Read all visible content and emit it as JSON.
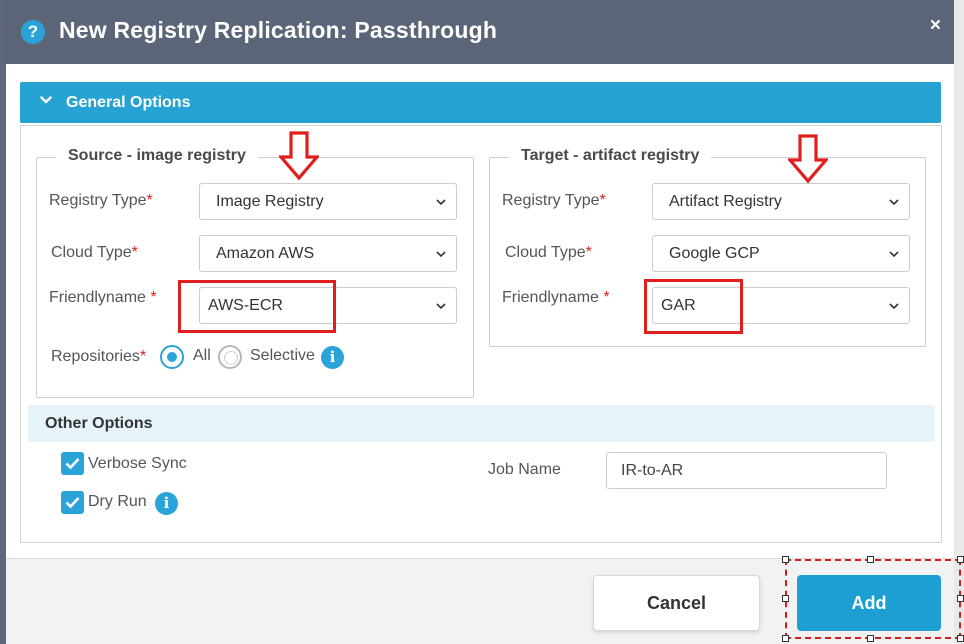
{
  "dialog": {
    "title": "New Registry Replication: Passthrough",
    "help_icon": "?",
    "close_icon": "×"
  },
  "section": {
    "title": "General Options"
  },
  "source": {
    "title": "Source - image registry",
    "registry_type_label": "Registry Type",
    "registry_type_value": "Image Registry",
    "cloud_type_label": "Cloud Type",
    "cloud_type_value": "Amazon AWS",
    "friendlyname_label": "Friendlyname",
    "friendlyname_value": "AWS-ECR",
    "repositories_label": "Repositories",
    "repo_all": "All",
    "repo_selective": "Selective",
    "repo_selected": "All"
  },
  "target": {
    "title": "Target - artifact registry",
    "registry_type_label": "Registry Type",
    "registry_type_value": "Artifact Registry",
    "cloud_type_label": "Cloud Type",
    "cloud_type_value": "Google GCP",
    "friendlyname_label": "Friendlyname",
    "friendlyname_value": "GAR"
  },
  "required_mark": "*",
  "info_icon": "i",
  "other": {
    "title": "Other Options",
    "verbose_sync": "Verbose Sync",
    "verbose_sync_checked": true,
    "dry_run": "Dry Run",
    "dry_run_checked": true,
    "job_name_label": "Job Name",
    "job_name_value": "IR-to-AR"
  },
  "buttons": {
    "cancel": "Cancel",
    "add": "Add"
  },
  "colors": {
    "titlebar": "#5c6577",
    "accent": "#26a3d3",
    "highlight": "#e01e1e"
  }
}
